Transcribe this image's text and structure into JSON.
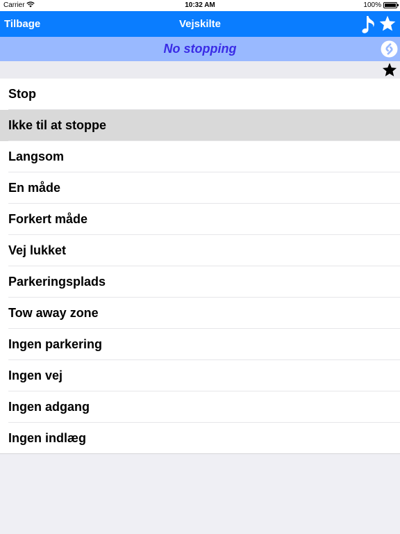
{
  "status_bar": {
    "carrier": "Carrier",
    "time": "10:32 AM",
    "battery": "100%"
  },
  "nav": {
    "back_label": "Tilbage",
    "title": "Vejskilte",
    "music_icon": "music-note-icon",
    "favorite_icon": "star-icon"
  },
  "banner": {
    "translation": "No stopping",
    "icon": "shazam-icon"
  },
  "subbar": {
    "icon": "star-icon"
  },
  "colors": {
    "nav_bg": "#0a7dff",
    "banner_bg": "#99b9ff",
    "banner_text": "#3a2ce6",
    "selected_row": "#d9d9d9"
  },
  "list": {
    "selected_index": 1,
    "items": [
      {
        "label": "Stop"
      },
      {
        "label": "Ikke til at stoppe"
      },
      {
        "label": "Langsom"
      },
      {
        "label": "En måde"
      },
      {
        "label": "Forkert måde"
      },
      {
        "label": "Vej lukket"
      },
      {
        "label": "Parkeringsplads"
      },
      {
        "label": "Tow away zone"
      },
      {
        "label": "Ingen parkering"
      },
      {
        "label": "Ingen vej"
      },
      {
        "label": "Ingen adgang"
      },
      {
        "label": "Ingen indlæg"
      }
    ]
  }
}
